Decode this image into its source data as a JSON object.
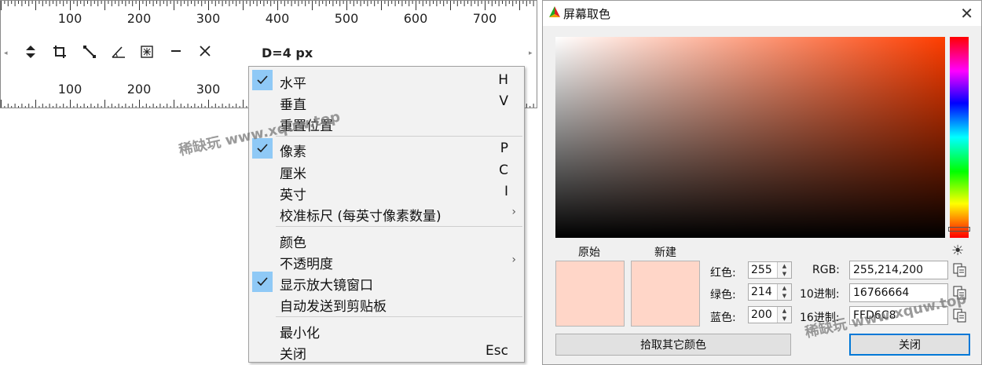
{
  "ruler": {
    "top_ticks": [
      "100",
      "200",
      "300",
      "400",
      "500",
      "600",
      "700"
    ],
    "bottom_ticks": [
      "100",
      "200",
      "300"
    ],
    "distance": "D=4 px",
    "tools": [
      "move-updown-icon",
      "crop-icon",
      "diagonal-line-icon",
      "angle-icon",
      "center-point-icon",
      "minimize-line-icon",
      "close-icon"
    ]
  },
  "menu": {
    "items": [
      {
        "label": "水平",
        "key": "H",
        "checked": true
      },
      {
        "label": "垂直",
        "key": "V",
        "checked": false
      },
      {
        "label": "重置位置",
        "key": "",
        "checked": false
      },
      {
        "label": "像素",
        "key": "P",
        "checked": true
      },
      {
        "label": "厘米",
        "key": "C",
        "checked": false
      },
      {
        "label": "英寸",
        "key": "I",
        "checked": false
      },
      {
        "label": "校准标尺 (每英寸像素数量)",
        "key": "",
        "checked": false,
        "submenu": true
      },
      {
        "label": "颜色",
        "key": "",
        "checked": false
      },
      {
        "label": "不透明度",
        "key": "",
        "checked": false,
        "submenu": true
      },
      {
        "label": "显示放大镜窗口",
        "key": "",
        "checked": true
      },
      {
        "label": "自动发送到剪贴板",
        "key": "",
        "checked": false
      },
      {
        "label": "最小化",
        "key": "",
        "checked": false
      },
      {
        "label": "关闭",
        "key": "Esc",
        "checked": false
      }
    ]
  },
  "watermark": "稀缺玩 www.xquw.top",
  "picker": {
    "title": "屏幕取色",
    "original_label": "原始",
    "new_label": "新建",
    "original_color": "#FFD6C8",
    "new_color": "#FFD6C8",
    "red_label": "红色:",
    "green_label": "绿色:",
    "blue_label": "蓝色:",
    "red": "255",
    "green": "214",
    "blue": "200",
    "rgb_label": "RGB:",
    "dec_label": "10进制:",
    "hex_label": "16进制:",
    "rgb_value": "255,214,200",
    "dec_value": "16766664",
    "hex_value": "FFD6C8",
    "pick_button": "拾取其它颜色",
    "close_button": "关闭"
  }
}
